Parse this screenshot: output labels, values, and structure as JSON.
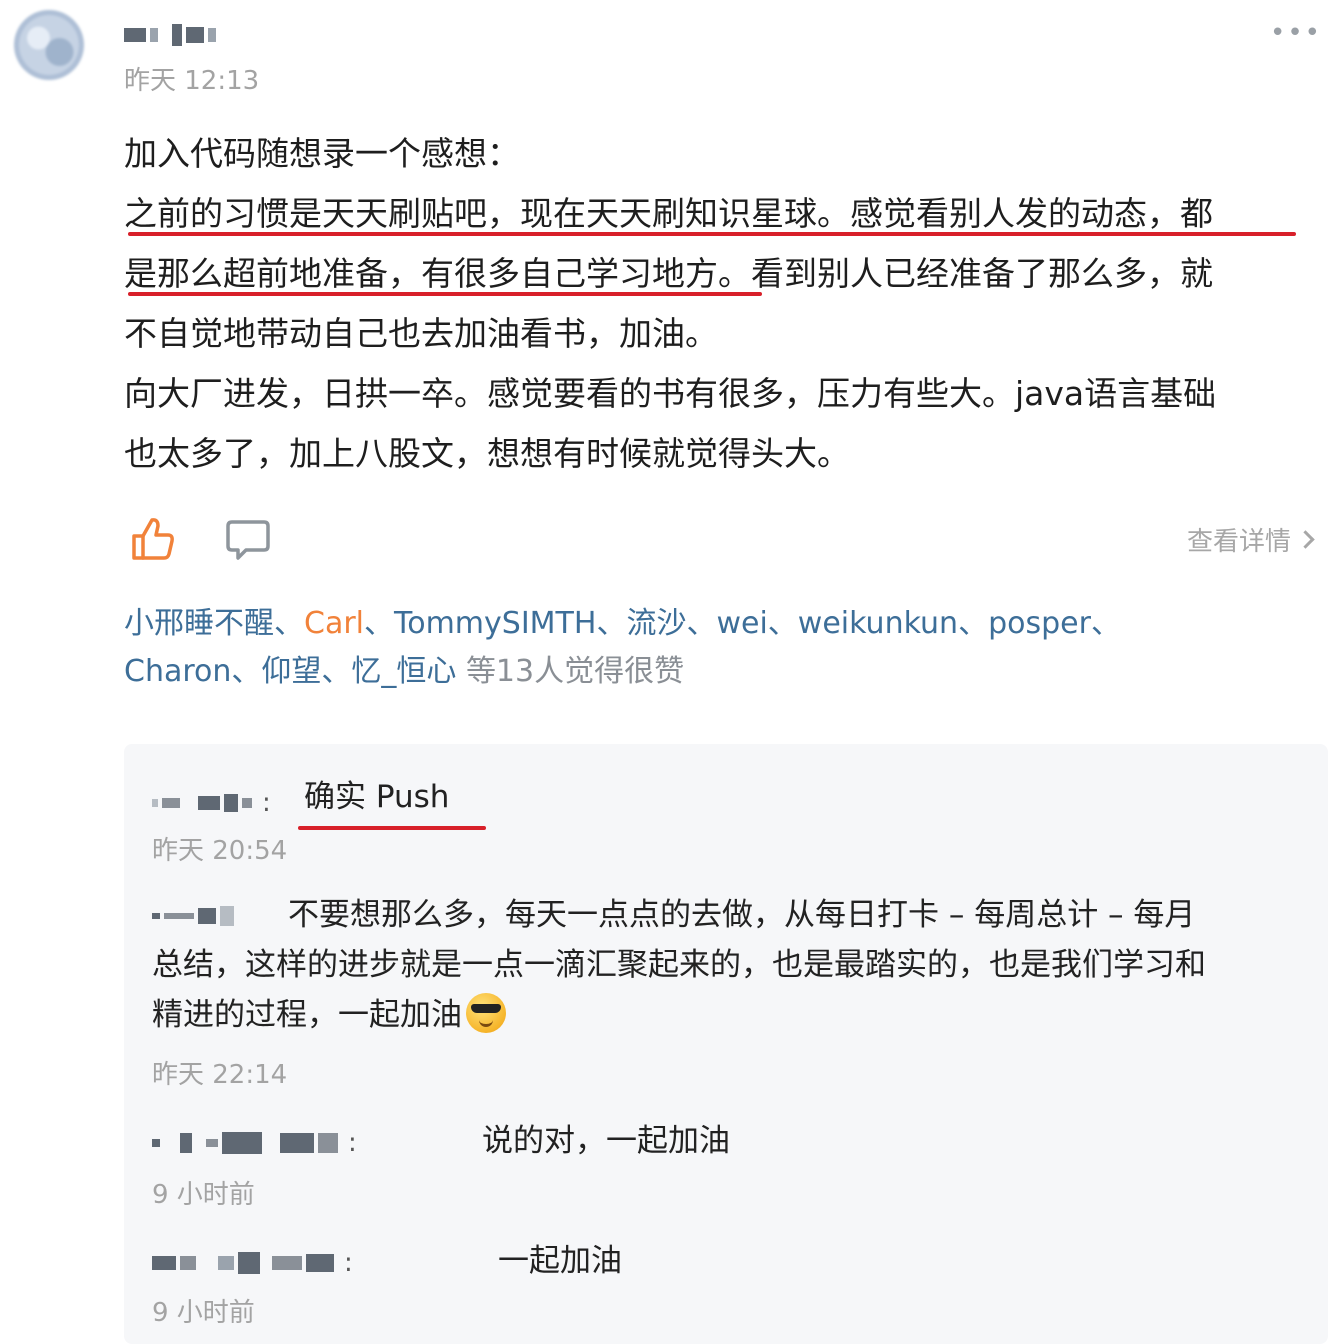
{
  "post": {
    "time": "昨天 12:13",
    "lines": [
      "加入代码随想录一个感想：",
      "之前的习惯是天天刷贴吧，现在天天刷知识星球。感觉看别人发的动态，都",
      "是那么超前地准备，有很多自己学习地方。看到别人已经准备了那么多，就",
      "不自觉地带动自己也去加油看书，加油。",
      "向大厂进发，日拱一卒。感觉要看的书有很多，压力有些大。java语言基础",
      "也太多了，加上八股文，想想有时候就觉得头大。"
    ]
  },
  "actions": {
    "like_icon": "thumbs-up-icon",
    "comment_icon": "comment-bubble-icon",
    "more_icon": "more-dots-icon",
    "detail_label": "查看详情"
  },
  "likes": {
    "names": [
      "小邢睡不醒",
      "Carl",
      "TommySIMTH",
      "流沙",
      "wei",
      "weikunkun",
      "posper",
      "Charon",
      "仰望",
      "忆_恒心"
    ],
    "separator": "、",
    "summary": "等13人觉得很赞"
  },
  "comments": [
    {
      "text": "确实 Push",
      "time": "昨天 20:54"
    },
    {
      "text": "不要想那么多，每天一点点的去做，从每日打卡 – 每周总计 – 每月",
      "text2": "总结，这样的进步就是一点一滴汇聚起来的，也是最踏实的，也是我们学习和",
      "text3": "精进的过程，一起加油",
      "time": "昨天 22:14"
    },
    {
      "text": "说的对，一起加油",
      "time": "9 小时前"
    },
    {
      "text": "一起加油",
      "time": "9 小时前"
    }
  ],
  "colors": {
    "highlight": "#d8202a",
    "link": "#3d6e98",
    "accent": "#f1823a"
  }
}
